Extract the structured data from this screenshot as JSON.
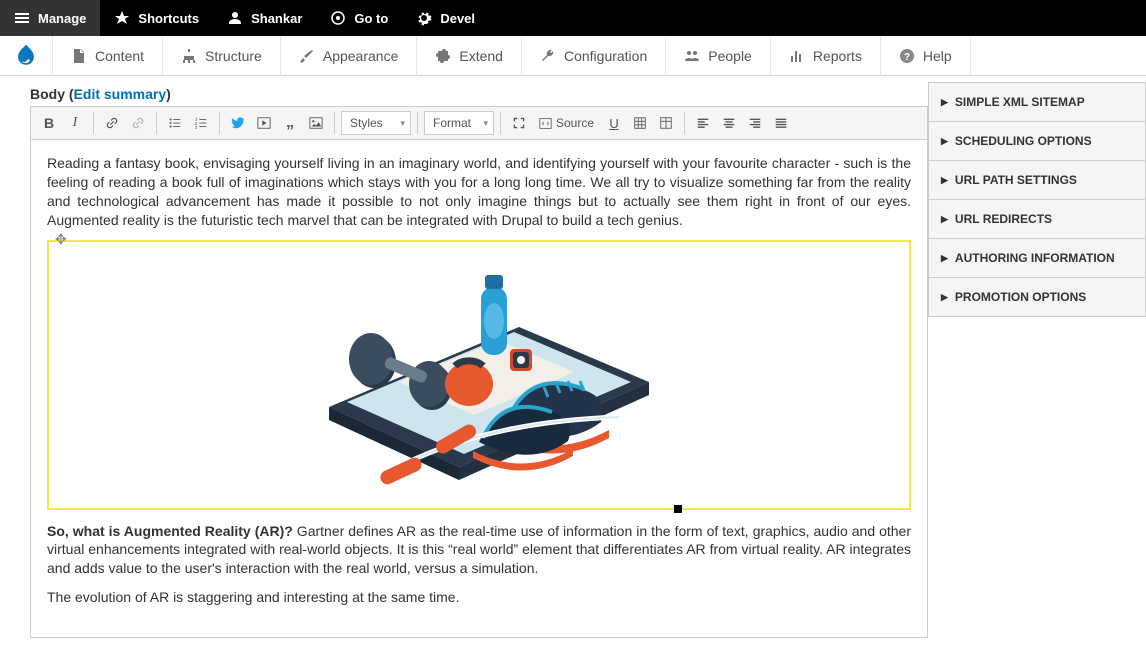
{
  "topbar": {
    "manage": "Manage",
    "shortcuts": "Shortcuts",
    "user": "Shankar",
    "goto": "Go to",
    "devel": "Devel"
  },
  "secondbar": {
    "content": "Content",
    "structure": "Structure",
    "appearance": "Appearance",
    "extend": "Extend",
    "configuration": "Configuration",
    "people": "People",
    "reports": "Reports",
    "help": "Help"
  },
  "body": {
    "label": "Body",
    "edit_summary": "Edit summary"
  },
  "toolbar": {
    "styles": "Styles",
    "format": "Format",
    "source": "Source"
  },
  "content": {
    "p1": "Reading a fantasy book, envisaging yourself living in an imaginary world, and identifying yourself with your favourite character - such is the feeling of reading a book full of imaginations which stays with you for a long long time. We all try to visualize something far from the reality and technological advancement has made it possible to not only imagine things but to actually see them right in front of our eyes. Augmented reality is the futuristic tech marvel that can be integrated with Drupal to build a tech genius.",
    "p2_bold": "So, what is Augmented Reality (AR)?",
    "p2_rest": " Gartner defines AR as the real-time use of information in the form of text, graphics, audio and other virtual enhancements integrated with real-world objects. It is this “real world” element that differentiates AR from virtual reality. AR integrates and adds value to the user's interaction with the real world, versus a simulation.",
    "p3": "The evolution of AR is staggering and interesting at the same time."
  },
  "sidebar": {
    "items": [
      "SIMPLE XML SITEMAP",
      "SCHEDULING OPTIONS",
      "URL PATH SETTINGS",
      "URL REDIRECTS",
      "AUTHORING INFORMATION",
      "PROMOTION OPTIONS"
    ]
  }
}
